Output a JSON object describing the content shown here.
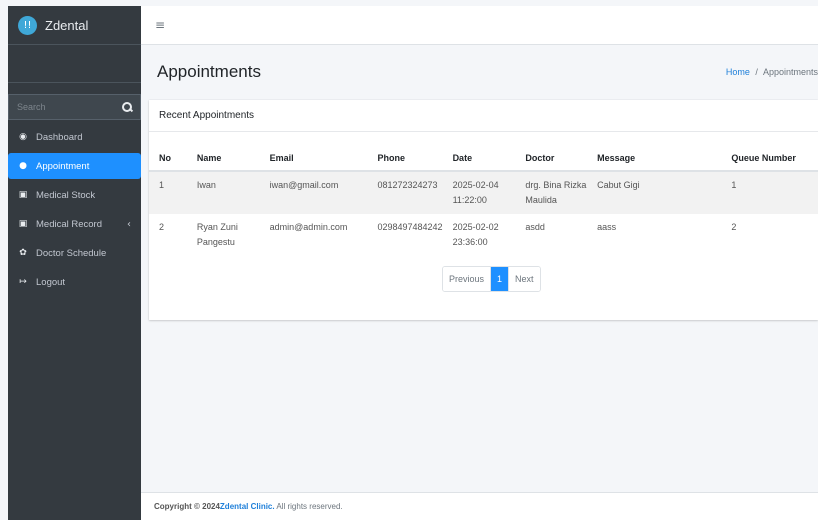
{
  "brand": {
    "logo_glyph": "!!",
    "name": "Zdental"
  },
  "topbar": {
    "menu_icon": "≡"
  },
  "search": {
    "placeholder": "Search"
  },
  "nav": [
    {
      "label": "Dashboard",
      "icon": "dashboard-icon",
      "glyph": "◉",
      "active": false
    },
    {
      "label": "Appointment",
      "icon": "chat-icon",
      "glyph": "●",
      "active": true
    },
    {
      "label": "Medical Stock",
      "icon": "box-icon",
      "glyph": "▣",
      "active": false
    },
    {
      "label": "Medical Record",
      "icon": "record-icon",
      "glyph": "▣",
      "active": false,
      "chevron": "‹"
    },
    {
      "label": "Doctor Schedule",
      "icon": "calendar-icon",
      "glyph": "✿",
      "active": false
    },
    {
      "label": "Logout",
      "icon": "logout-icon",
      "glyph": "↦",
      "active": false
    }
  ],
  "header": {
    "title": "Appointments",
    "breadcrumb_home": "Home",
    "breadcrumb_sep": "/",
    "breadcrumb_current": "Appointments"
  },
  "card": {
    "title": "Recent Appointments"
  },
  "table": {
    "columns": [
      "No",
      "Name",
      "Email",
      "Phone",
      "Date",
      "Doctor",
      "Message",
      "Queue Number"
    ],
    "rows": [
      [
        "1",
        "Iwan",
        "iwan@gmail.com",
        "081272324273",
        "2025-02-04 11:22:00",
        "drg. Bina Rizka Maulida",
        "Cabut Gigi",
        "1"
      ],
      [
        "2",
        "Ryan Zuni Pangestu",
        "admin@admin.com",
        "0298497484242",
        "2025-02-02 23:36:00",
        "asdd",
        "aass",
        "2"
      ]
    ]
  },
  "pagination": {
    "previous": "Previous",
    "current": "1",
    "next": "Next"
  },
  "footer": {
    "prefix": "Copyright © 2024 ",
    "brand": "Zdental Clinic.",
    "suffix": " All rights reserved."
  },
  "colors": {
    "sidebar": "#343a40",
    "accent": "#1e90ff",
    "link": "#1e7fd9"
  }
}
